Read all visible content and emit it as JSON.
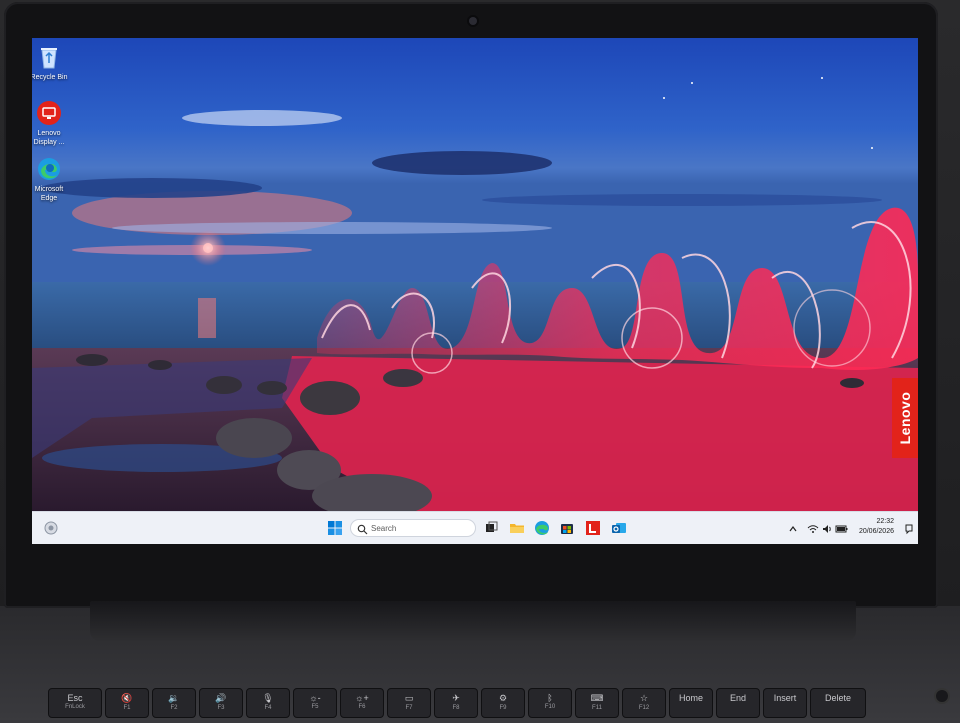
{
  "desktop": {
    "icons": [
      {
        "label": "Recycle Bin",
        "icon": "recycle-bin-icon"
      },
      {
        "label": "Lenovo Display ...",
        "icon": "lenovo-display-icon"
      },
      {
        "label": "Microsoft Edge",
        "icon": "edge-icon"
      }
    ],
    "brand": "Lenovo"
  },
  "taskbar": {
    "search_placeholder": "Search",
    "apps": [
      "start-icon",
      "search-icon",
      "task-view-icon",
      "file-explorer-icon",
      "edge-icon",
      "store-icon",
      "lenovo-app-icon",
      "outlook-icon"
    ],
    "clock": {
      "time": "22:32",
      "date": "20/06/2026"
    },
    "tray": [
      "chevron-up-icon",
      "wifi-icon",
      "volume-icon",
      "battery-icon",
      "notification-icon"
    ]
  },
  "keyboard": {
    "keys": [
      {
        "label": "Esc",
        "sub": "FnLock"
      },
      {
        "label": "🔇",
        "sub": "F1"
      },
      {
        "label": "🔉",
        "sub": "F2"
      },
      {
        "label": "🔊",
        "sub": "F3"
      },
      {
        "label": "🎙",
        "sub": "F4"
      },
      {
        "label": "☼-",
        "sub": "F5"
      },
      {
        "label": "☼+",
        "sub": "F6"
      },
      {
        "label": "▭",
        "sub": "F7"
      },
      {
        "label": "✈",
        "sub": "F8"
      },
      {
        "label": "⚙",
        "sub": "F9"
      },
      {
        "label": "ᛒ",
        "sub": "F10"
      },
      {
        "label": "⌨",
        "sub": "F11"
      },
      {
        "label": "☆",
        "sub": "F12"
      },
      {
        "label": "Home",
        "sub": ""
      },
      {
        "label": "End",
        "sub": ""
      },
      {
        "label": "Insert",
        "sub": ""
      },
      {
        "label": "Delete",
        "sub": ""
      }
    ]
  },
  "colors": {
    "lenovo_red": "#e2231a",
    "taskbar_bg": "#eef1f7",
    "accent_blue": "#0067c0"
  }
}
